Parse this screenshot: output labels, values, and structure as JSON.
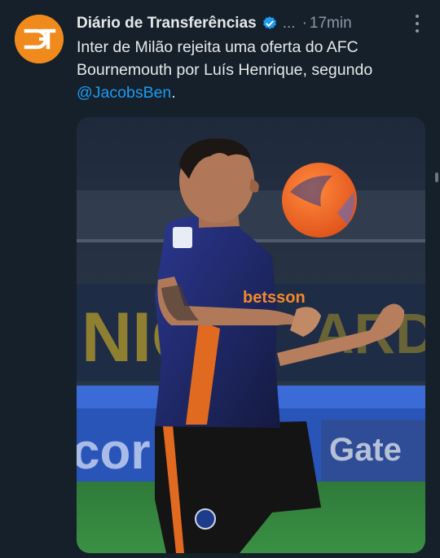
{
  "account": {
    "display_name": "Diário de Transferências",
    "handle_truncated": "...",
    "separator": "·",
    "time": "17min",
    "avatar_text": "ƆT"
  },
  "tweet": {
    "text_before_mention": "Inter de Milão rejeita uma oferta do AFC Bournemouth por Luís Henrique, segundo ",
    "mention": "@JacobsBen",
    "text_after_mention": "."
  },
  "media": {
    "ball_branding": "",
    "shirt_sponsor": "betsson",
    "board_text_left": "cor",
    "board_text_right": "Gate"
  },
  "colors": {
    "background": "#15202b",
    "text_primary": "#e7e9ea",
    "text_secondary": "#8b98a5",
    "accent": "#1d9bf0",
    "avatar": "#f08a1c"
  },
  "icons": {
    "verified": "verified-badge-icon",
    "more": "more-options-icon"
  }
}
